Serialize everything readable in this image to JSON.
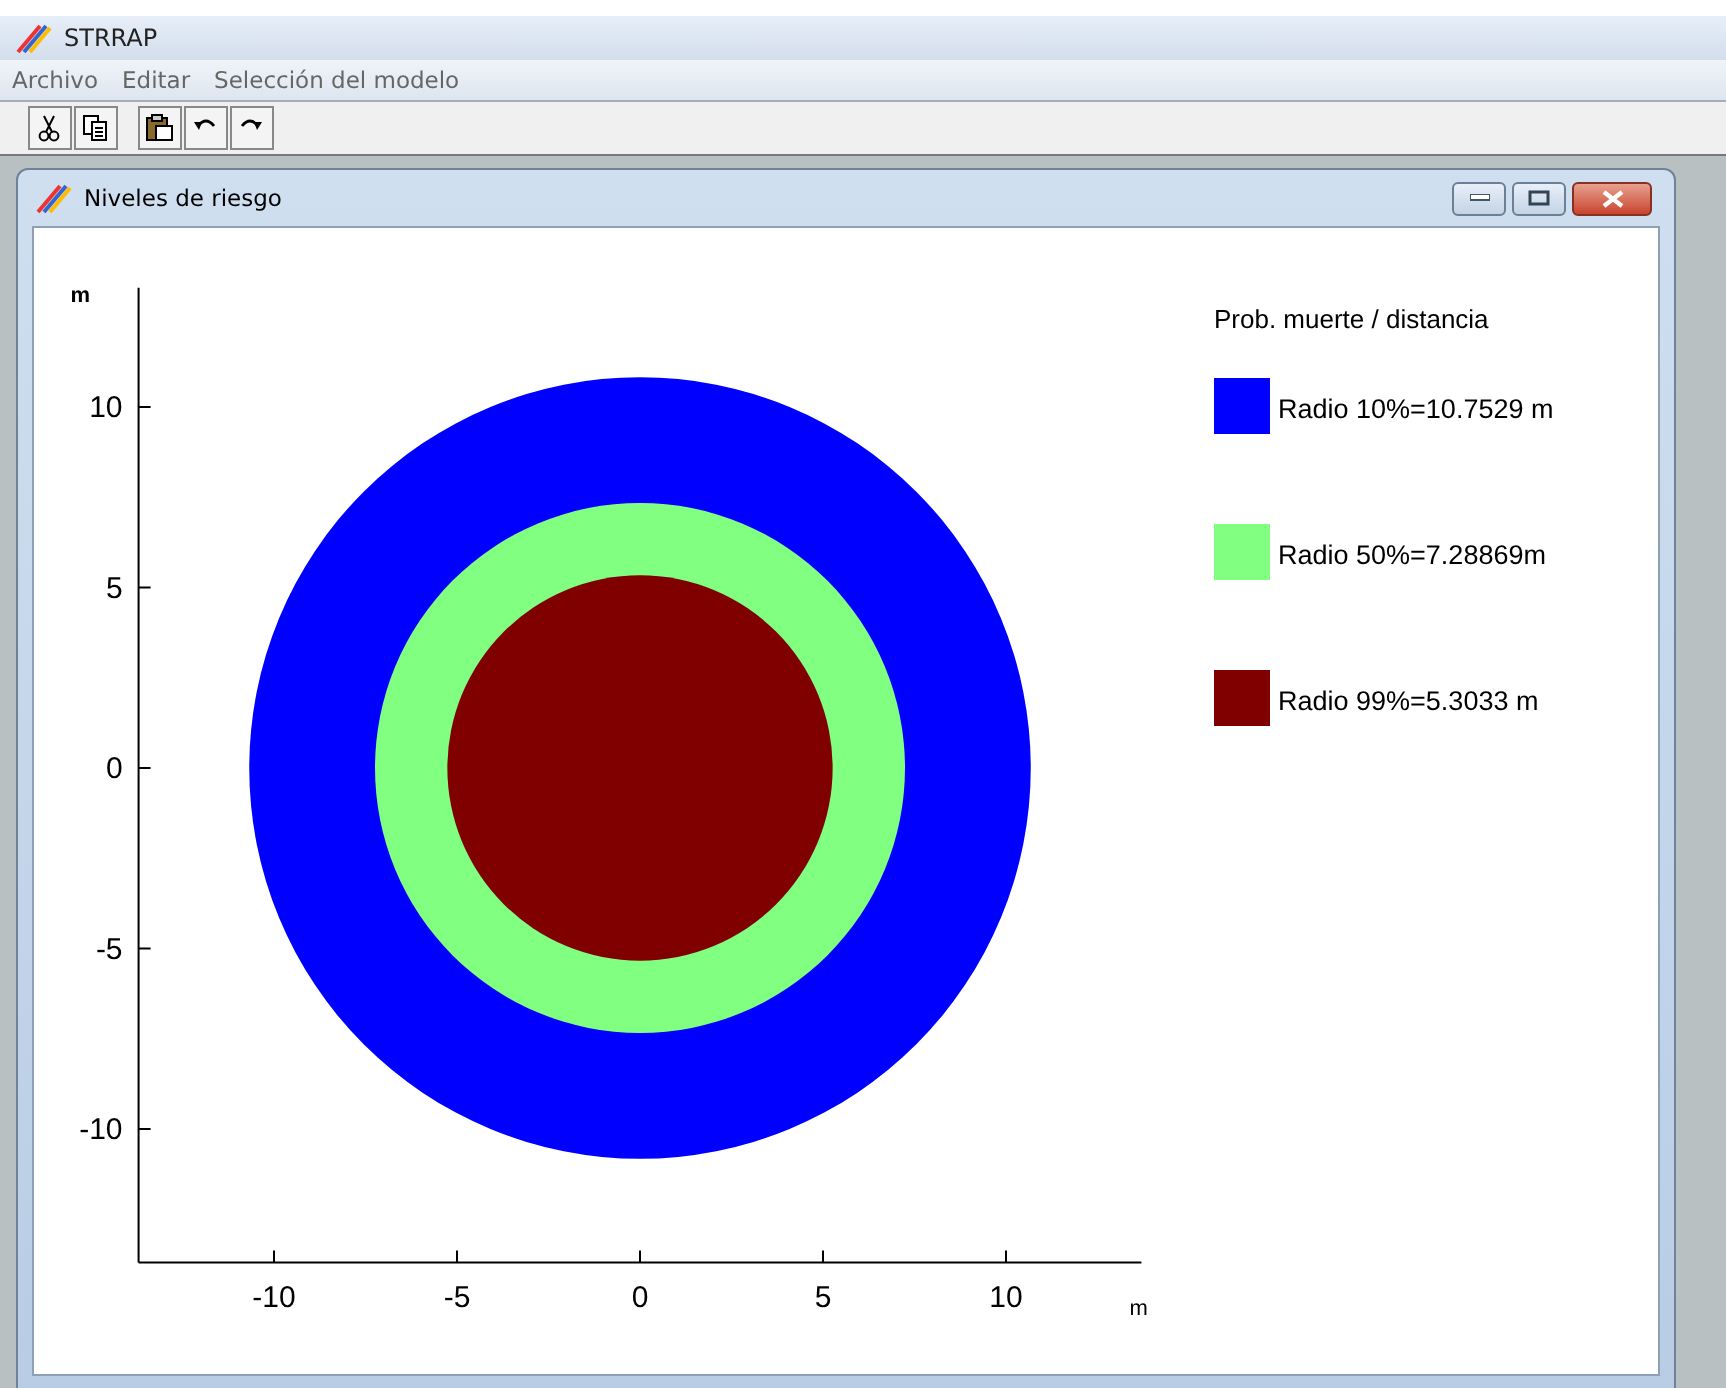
{
  "window": {
    "title": "STRRAP"
  },
  "menu": [
    "Archivo",
    "Editar",
    "Selección del modelo"
  ],
  "toolbar": [
    {
      "kind": "cut"
    },
    {
      "kind": "copy"
    },
    {
      "kind": "paste"
    },
    {
      "kind": "undo"
    },
    {
      "kind": "redo"
    }
  ],
  "child_window": {
    "title": "Niveles de riesgo",
    "plot": {
      "y_axis_label": "m",
      "x_axis_label": "m",
      "y_tick_labels": [
        "10",
        "5",
        "0",
        "-5",
        "-10"
      ],
      "x_tick_labels": [
        "-10",
        "-5",
        "0",
        "5",
        "10"
      ],
      "legend_title": "Prob. muerte / distancia",
      "legend": [
        {
          "label": "Radio 10%=10.7529 m",
          "color": "#0000ff"
        },
        {
          "label": "Radio 50%=7.28869m",
          "color": "#80ff80"
        },
        {
          "label": "Radio 99%=5.3033 m",
          "color": "#800000"
        }
      ]
    }
  }
}
